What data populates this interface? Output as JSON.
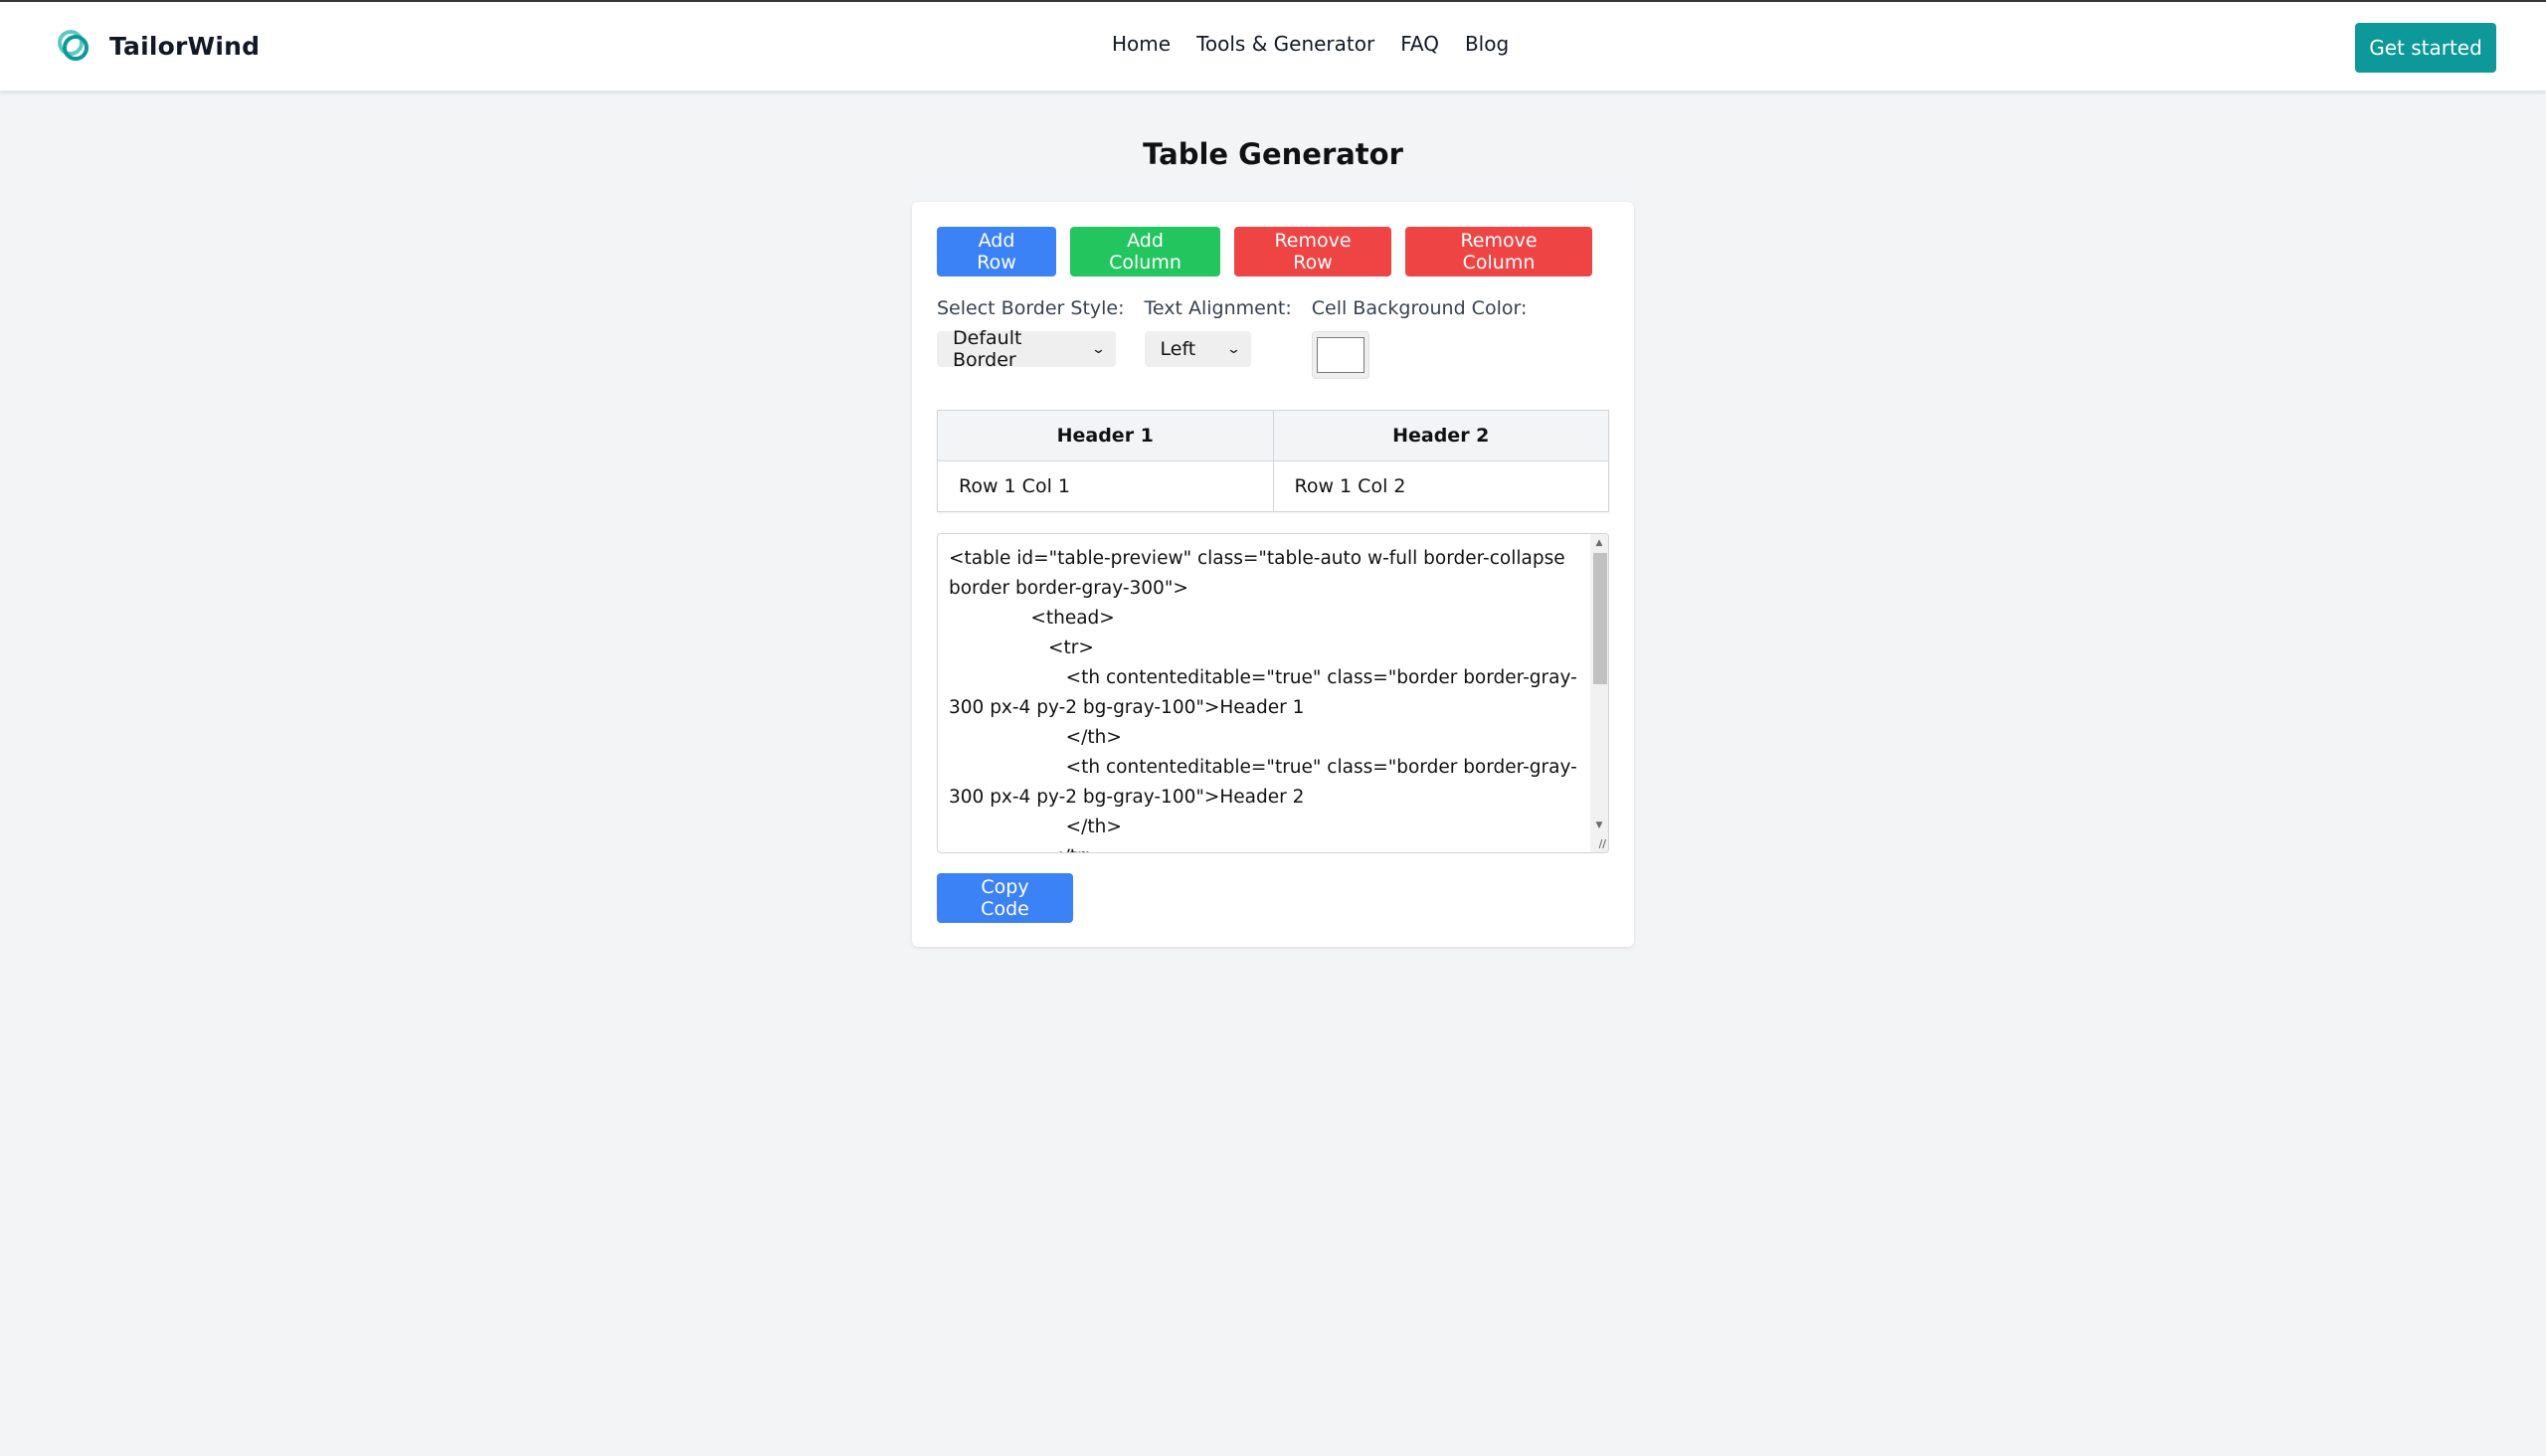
{
  "navbar": {
    "brand": "TailorWind",
    "links": [
      "Home",
      "Tools & Generator",
      "FAQ",
      "Blog"
    ],
    "cta_label": "Get started",
    "accent_color": "#0d9999"
  },
  "page": {
    "title": "Table Generator"
  },
  "toolbar": {
    "add_row": "Add Row",
    "add_column": "Add Column",
    "remove_row": "Remove Row",
    "remove_column": "Remove Column"
  },
  "controls": {
    "border_style_label": "Select Border Style:",
    "border_style_value": "Default Border",
    "alignment_label": "Text Alignment:",
    "alignment_value": "Left",
    "bg_color_label": "Cell Background Color:",
    "bg_color_value": "#ffffff"
  },
  "table": {
    "headers": [
      "Header 1",
      "Header 2"
    ],
    "rows": [
      [
        "Row 1 Col 1",
        "Row 1 Col 2"
      ]
    ]
  },
  "code": {
    "text": "<table id=\"table-preview\" class=\"table-auto w-full border-collapse border border-gray-300\">\n              <thead>\n                 <tr>\n                    <th contenteditable=\"true\" class=\"border border-gray-300 px-4 py-2 bg-gray-100\">Header 1\n                    </th>\n                    <th contenteditable=\"true\" class=\"border border-gray-300 px-4 py-2 bg-gray-100\">Header 2\n                    </th>\n                 </tr>"
  },
  "copy_label": "Copy Code"
}
